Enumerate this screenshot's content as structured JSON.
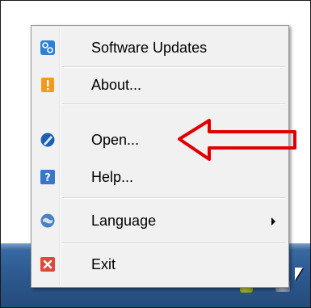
{
  "menu": {
    "items": [
      {
        "label": "Software Updates",
        "icon": "software-updates-icon",
        "separator_after": true
      },
      {
        "label": "About...",
        "icon": "about-warning-icon",
        "separator_after": true
      },
      {
        "label": "Open...",
        "icon": "open-app-icon",
        "separator_after": false
      },
      {
        "label": "Help...",
        "icon": "help-icon",
        "separator_after": true
      },
      {
        "label": "Language",
        "icon": "language-globe-icon",
        "has_submenu": true,
        "separator_after": true
      },
      {
        "label": "Exit",
        "icon": "exit-icon",
        "separator_after": false
      }
    ]
  },
  "annotation": {
    "type": "arrow",
    "color": "#e00000",
    "points_to": "Open..."
  },
  "colors": {
    "menu_bg": "#f1f1f1",
    "taskbar": "#2f5c93",
    "annotation_red": "#e00000"
  }
}
